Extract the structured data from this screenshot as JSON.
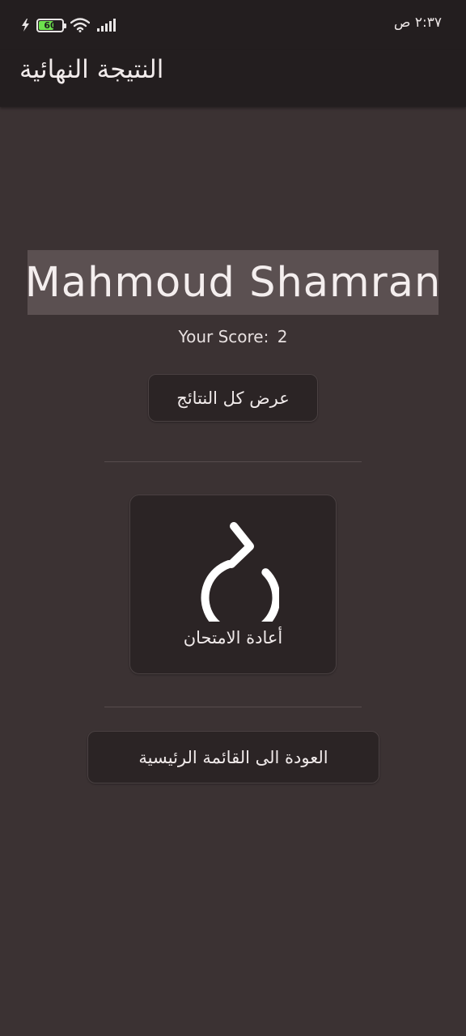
{
  "status_bar": {
    "battery_level": "60",
    "battery_fraction": 0.6,
    "time": "٢:٣٧ ص",
    "icons": [
      "charging-bolt-icon",
      "battery-icon",
      "wifi-icon",
      "cellular-signal-icon"
    ],
    "battery_color": "#6ee14e"
  },
  "app_bar": {
    "title": "النتيجة النهائية"
  },
  "result": {
    "name": "Mahmoud Shamran",
    "score_label": "Your Score:",
    "score_value": "2"
  },
  "actions": {
    "show_all_results": "عرض كل النتائج",
    "retake_exam": "أعادة الامتحان",
    "retake_icon": "refresh-icon",
    "back_to_main_menu": "العودة الى القائمة الرئيسية"
  },
  "colors": {
    "background": "#3b3233",
    "app_bar": "#231e1f",
    "button": "#2b2425",
    "name_box": "#5b5051"
  }
}
